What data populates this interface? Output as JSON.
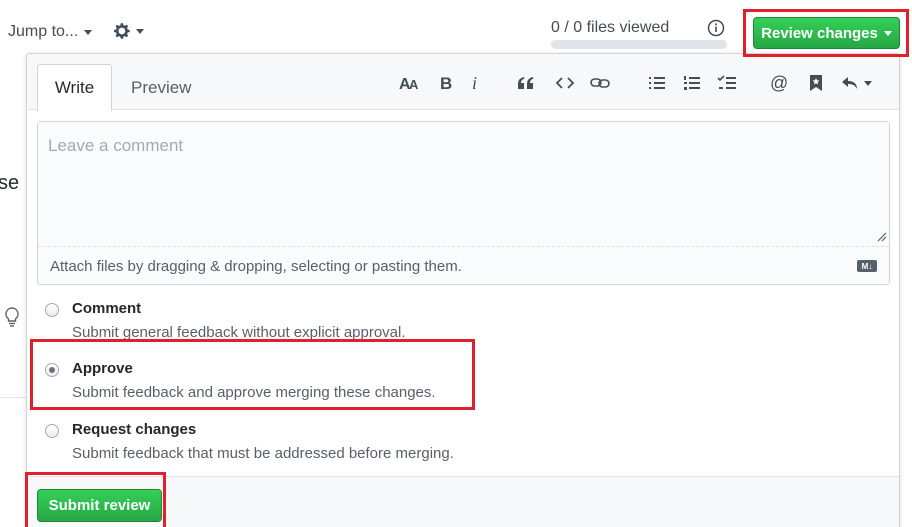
{
  "header": {
    "jump_label": "Jump to...",
    "files_viewed": "0 / 0 files viewed",
    "review_button": "Review changes"
  },
  "page_fragments": {
    "heading_tail": "se"
  },
  "editor": {
    "tabs": [
      {
        "label": "Write"
      },
      {
        "label": "Preview"
      }
    ],
    "toolbar_icons": [
      "text-size-icon",
      "bold-icon",
      "italic-icon",
      "quote-icon",
      "code-icon",
      "link-icon",
      "bullet-list-icon",
      "numbered-list-icon",
      "task-list-icon",
      "mention-icon",
      "saved-reply-icon",
      "reply-icon"
    ],
    "placeholder": "Leave a comment",
    "attach_hint": "Attach files by dragging & dropping, selecting or pasting them.",
    "markdown_badge": "M↓"
  },
  "options": [
    {
      "title": "Comment",
      "description": "Submit general feedback without explicit approval.",
      "checked": false
    },
    {
      "title": "Approve",
      "description": "Submit feedback and approve merging these changes.",
      "checked": true
    },
    {
      "title": "Request changes",
      "description": "Submit feedback that must be addressed before merging.",
      "checked": false
    }
  ],
  "submit_button": "Submit review",
  "colors": {
    "accent_green": "#28a745",
    "highlight_red": "#e0202b"
  }
}
